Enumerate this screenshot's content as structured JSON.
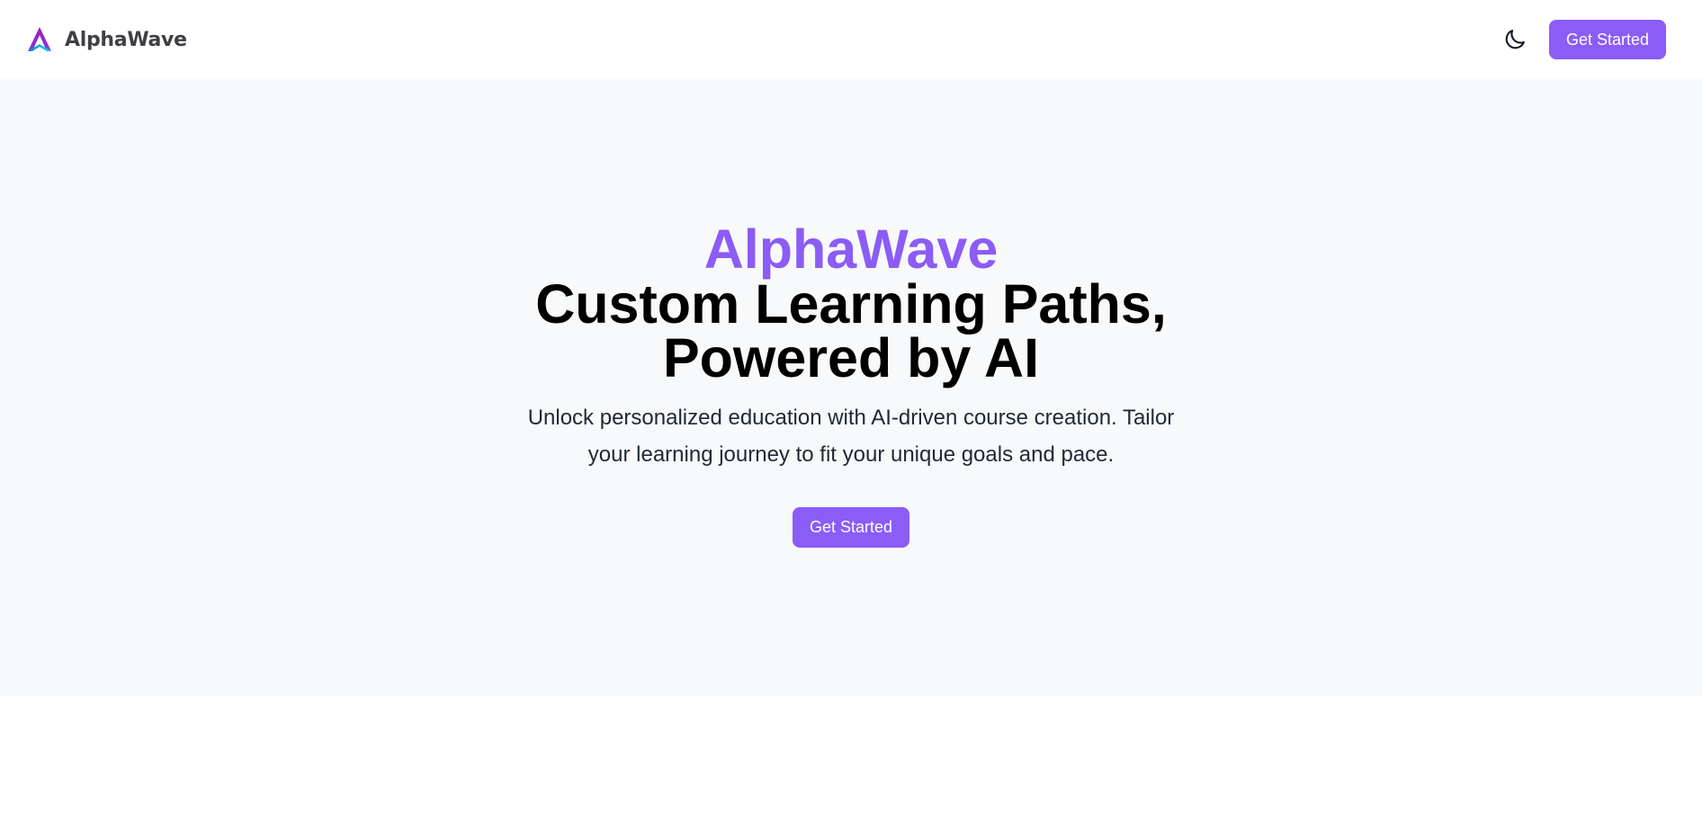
{
  "navbar": {
    "brand_name": "AlphaWave",
    "brand_logo_icon": "alphawave-logo-icon",
    "theme_toggle_icon": "moon-icon",
    "cta_label": "Get Started"
  },
  "hero": {
    "brand": "AlphaWave",
    "title": "Custom Learning Paths, Powered by AI",
    "subtitle": "Unlock personalized education with AI-driven course creation. Tailor your learning journey to fit your unique goals and pace.",
    "cta_label": "Get Started"
  },
  "colors": {
    "accent": "#8b5cf6",
    "hero_background": "#f8f9fa",
    "logo_magenta": "#a21caf",
    "logo_teal": "#06b6d4"
  }
}
